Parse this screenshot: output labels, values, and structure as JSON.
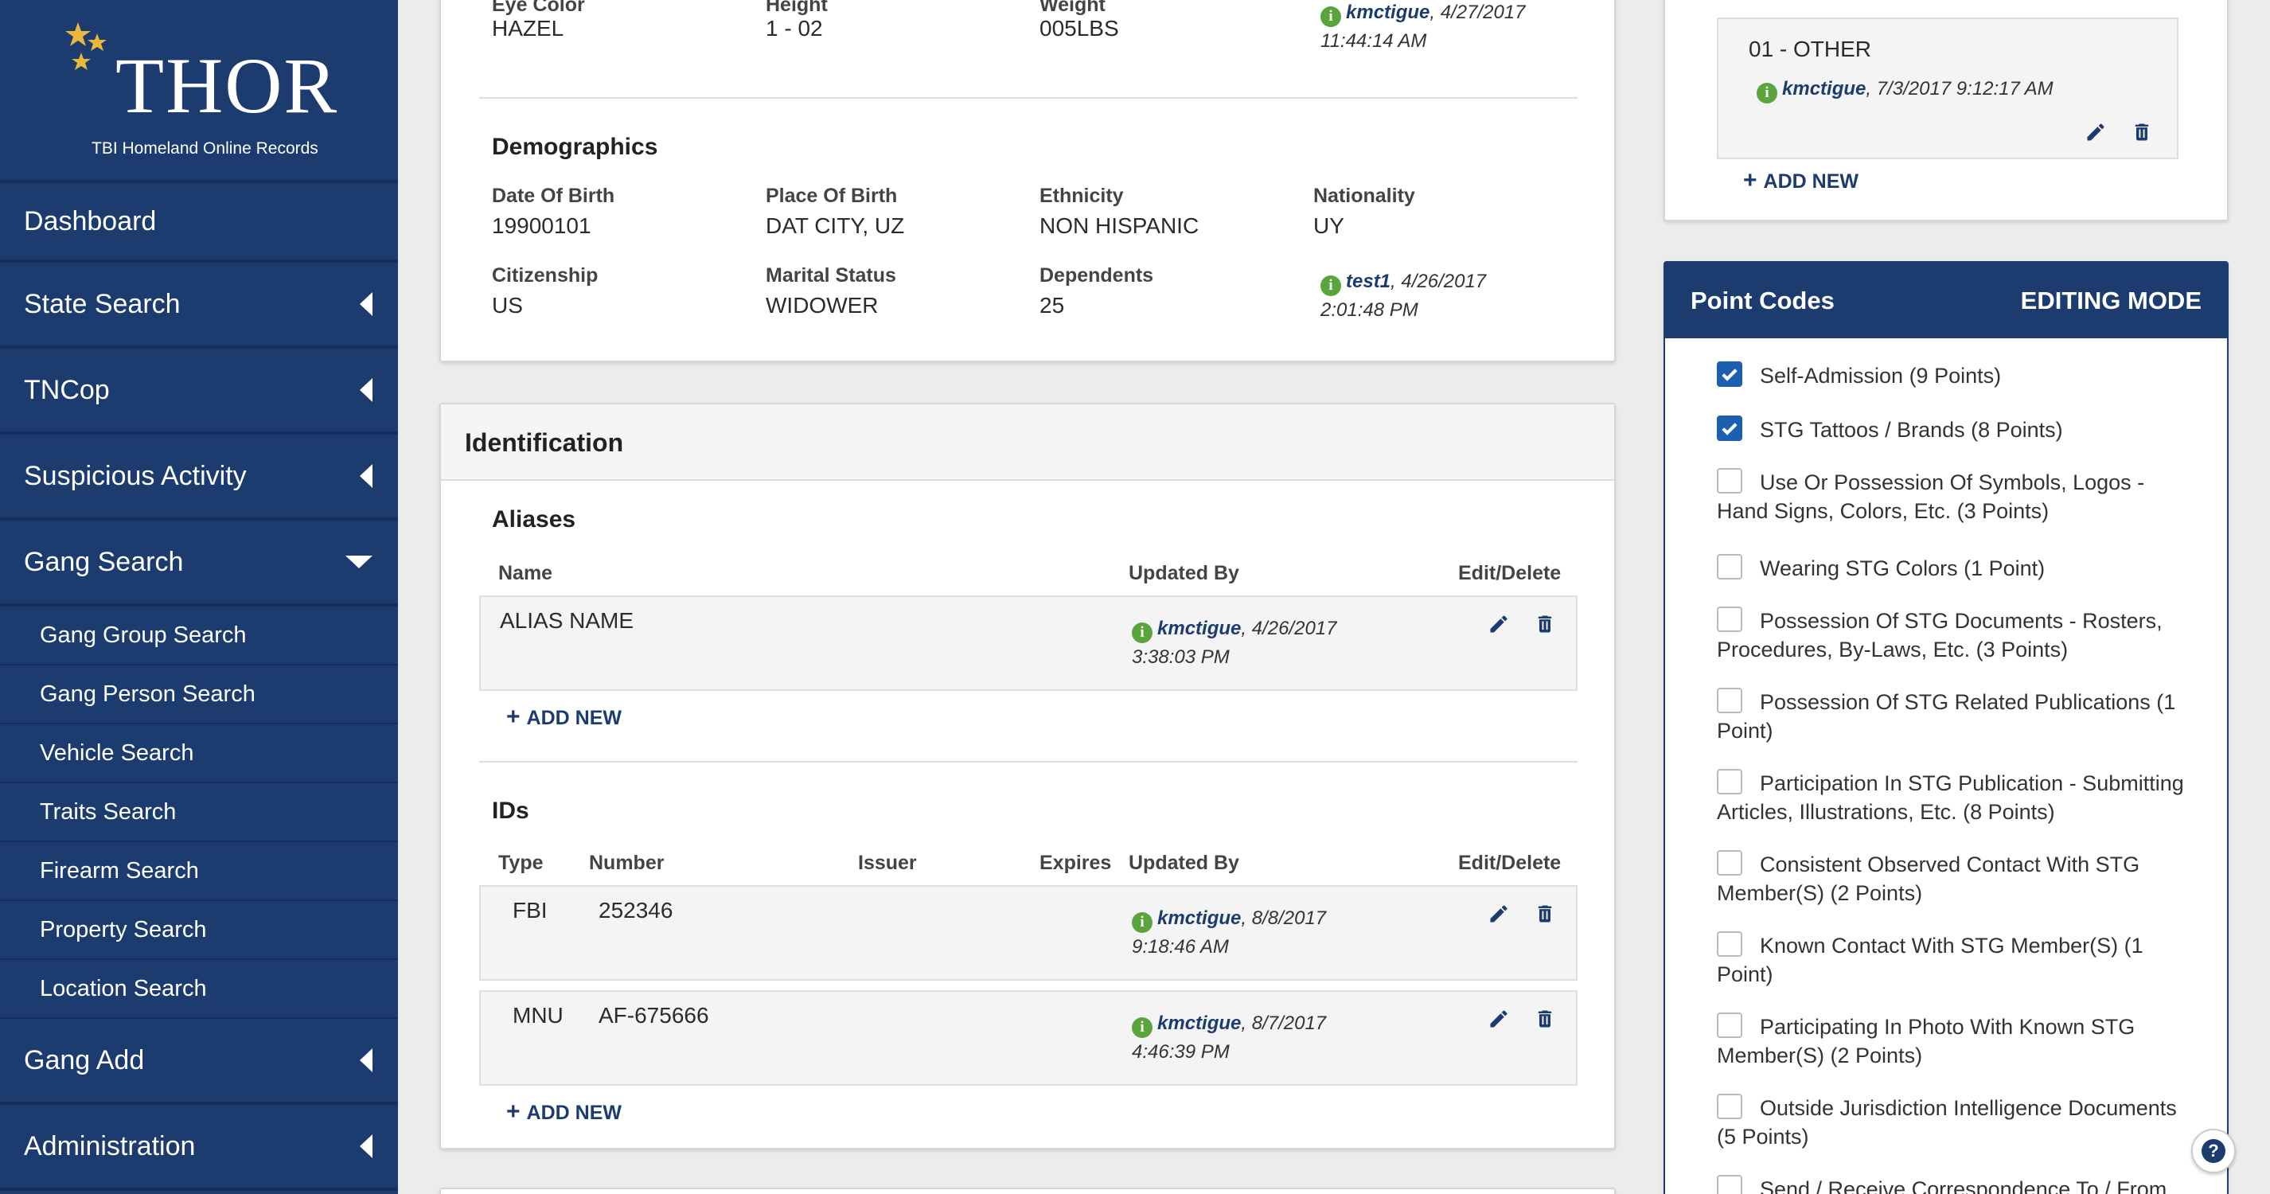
{
  "brand": {
    "title": "THOR",
    "subtitle": "TBI Homeland Online Records"
  },
  "nav": {
    "dashboard": "Dashboard",
    "state_search": "State Search",
    "tncop": "TNCop",
    "suspicious_activity": "Suspicious Activity",
    "gang_search": "Gang Search",
    "gang_search_items": [
      "Gang Group Search",
      "Gang Person Search",
      "Vehicle Search",
      "Traits Search",
      "Firearm Search",
      "Property Search",
      "Location Search"
    ],
    "gang_add": "Gang Add",
    "administration": "Administration"
  },
  "physical": {
    "eye_color_label": "Eye Color",
    "eye_color": "HAZEL",
    "height_label": "Height",
    "height": "1 - 02",
    "weight_label": "Weight",
    "weight": "005LBS",
    "updated_user": "kmctigue",
    "updated_date": ", 4/27/2017",
    "updated_time": "11:44:14 AM"
  },
  "demographics": {
    "title": "Demographics",
    "dob_label": "Date Of Birth",
    "dob": "19900101",
    "pob_label": "Place Of Birth",
    "pob": "DAT CITY, UZ",
    "ethnicity_label": "Ethnicity",
    "ethnicity": "NON HISPANIC",
    "nationality_label": "Nationality",
    "nationality": "UY",
    "citizenship_label": "Citizenship",
    "citizenship": "US",
    "marital_label": "Marital Status",
    "marital": "WIDOWER",
    "dependents_label": "Dependents",
    "dependents": "25",
    "updated_user": "test1",
    "updated_date": ", 4/26/2017",
    "updated_time": "2:01:48 PM"
  },
  "identification": {
    "title": "Identification",
    "aliases": {
      "title": "Aliases",
      "col_name": "Name",
      "col_updated": "Updated By",
      "col_edit": "Edit/Delete",
      "rows": [
        {
          "name": "ALIAS NAME",
          "user": "kmctigue",
          "date": ", 4/26/2017",
          "time": "3:38:03 PM"
        }
      ],
      "add_new": "ADD NEW"
    },
    "ids": {
      "title": "IDs",
      "col_type": "Type",
      "col_number": "Number",
      "col_issuer": "Issuer",
      "col_expires": "Expires",
      "col_updated": "Updated By",
      "col_edit": "Edit/Delete",
      "rows": [
        {
          "type": "FBI",
          "number": "252346",
          "user": "kmctigue",
          "date": ", 8/8/2017",
          "time": "9:18:46 AM"
        },
        {
          "type": "MNU",
          "number": "AF-675666",
          "user": "kmctigue",
          "date": ", 8/7/2017",
          "time": "4:46:39 PM"
        }
      ],
      "add_new": "ADD NEW"
    }
  },
  "other_panel": {
    "entry": "01 - OTHER",
    "user": "kmctigue",
    "date": ", 7/3/2017 9:12:17 AM",
    "add_new": "ADD NEW"
  },
  "point_codes": {
    "title": "Point Codes",
    "mode": "EDITING MODE",
    "items": [
      {
        "label": "Self-Admission (9 Points)",
        "checked": true
      },
      {
        "label": "STG Tattoos / Brands (8 Points)",
        "checked": true
      },
      {
        "label": "Use Or Possession Of Symbols, Logos - Hand Signs, Colors, Etc. (3 Points)",
        "checked": false
      },
      {
        "label": "Wearing STG Colors (1 Point)",
        "checked": false
      },
      {
        "label": "Possession Of STG Documents - Rosters, Procedures, By-Laws, Etc. (3 Points)",
        "checked": false
      },
      {
        "label": "Possession Of STG Related Publications (1 Point)",
        "checked": false
      },
      {
        "label": "Participation In STG Publication - Submitting Articles, Illustrations, Etc. (8 Points)",
        "checked": false
      },
      {
        "label": "Consistent Observed Contact With STG Member(S) (2 Points)",
        "checked": false
      },
      {
        "label": "Known Contact With STG Member(S) (1 Point)",
        "checked": false
      },
      {
        "label": "Participating In Photo With Known STG Member(S) (2 Points)",
        "checked": false
      },
      {
        "label": "Outside Jurisdiction Intelligence Documents (5 Points)",
        "checked": false
      },
      {
        "label": "Send / Receive Correspondence To / From",
        "checked": false
      }
    ]
  },
  "help": {
    "label": "?"
  },
  "colors": {
    "navy": "#1c3b6e",
    "info_green": "#5aa53b",
    "checkbox_blue": "#1c5fb0"
  }
}
